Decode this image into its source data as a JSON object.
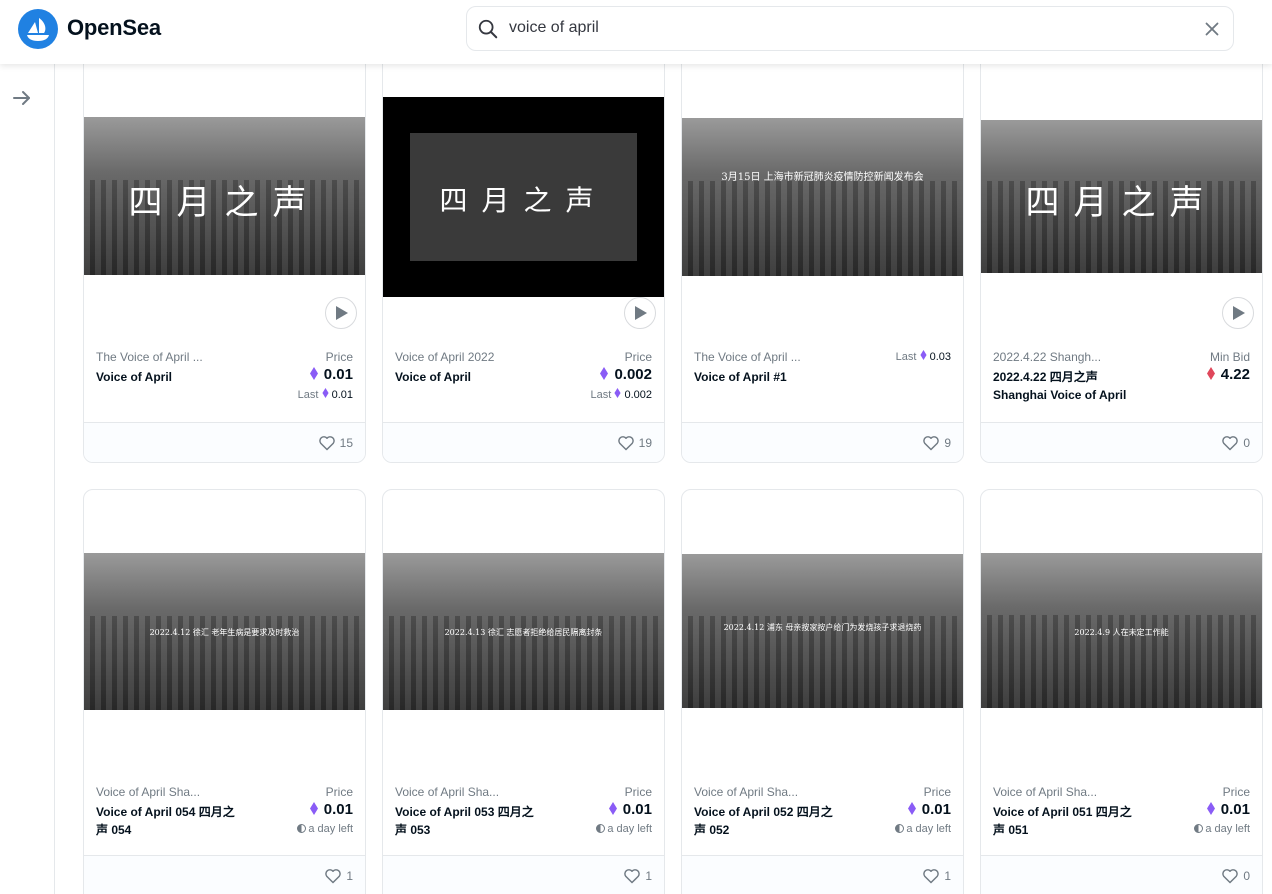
{
  "header": {
    "brand": "OpenSea",
    "search_value": "voice of april"
  },
  "colors": {
    "accent": "#2081e2",
    "eth": "#8a5cf6",
    "weth": "#e0475b"
  },
  "cards": [
    {
      "collection": "The Voice of April ...",
      "name": "Voice of April",
      "price_label": "Price",
      "price": "0.01",
      "last_label": "Last",
      "last": "0.01",
      "likes": "15",
      "thumb_text": "四月之声",
      "currency": "eth"
    },
    {
      "collection": "Voice of April 2022",
      "name": "Voice of April",
      "price_label": "Price",
      "price": "0.002",
      "last_label": "Last",
      "last": "0.002",
      "likes": "19",
      "thumb_text": "四月之声",
      "currency": "eth"
    },
    {
      "collection": "The Voice of April ...",
      "name": "Voice of April #1",
      "price_label": "",
      "price": "",
      "last_label": "Last",
      "last": "0.03",
      "likes": "9",
      "thumb_text": "3月15日 上海市新冠肺炎疫情防控新闻发布会",
      "currency": "eth"
    },
    {
      "collection": "2022.4.22 Shangh...",
      "name": "2022.4.22 四月之声 Shanghai Voice of April",
      "price_label": "Min Bid",
      "price": "4.22",
      "last_label": "",
      "last": "",
      "likes": "0",
      "thumb_text": "四月之声",
      "currency": "weth"
    },
    {
      "collection": "Voice of April Sha...",
      "name": "Voice of April 054 四月之声 054",
      "price_label": "Price",
      "price": "0.01",
      "time_left": "a day left",
      "likes": "1",
      "thumb_text": "2022.4.12 徐汇 老年生病是要求及时救治",
      "currency": "eth"
    },
    {
      "collection": "Voice of April Sha...",
      "name": "Voice of April 053 四月之声 053",
      "price_label": "Price",
      "price": "0.01",
      "time_left": "a day left",
      "likes": "1",
      "thumb_text": "2022.4.13 徐汇 志愿者拒绝给居民隔离封条",
      "currency": "eth"
    },
    {
      "collection": "Voice of April Sha...",
      "name": "Voice of April 052 四月之声 052",
      "price_label": "Price",
      "price": "0.01",
      "time_left": "a day left",
      "likes": "1",
      "thumb_text": "2022.4.12 浦东 母亲按家按户给门为发烧孩子求退烧药",
      "currency": "eth"
    },
    {
      "collection": "Voice of April Sha...",
      "name": "Voice of April 051 四月之声 051",
      "price_label": "Price",
      "price": "0.01",
      "time_left": "a day left",
      "likes": "0",
      "thumb_text": "2022.4.9 人在未定工作能",
      "currency": "eth"
    }
  ]
}
